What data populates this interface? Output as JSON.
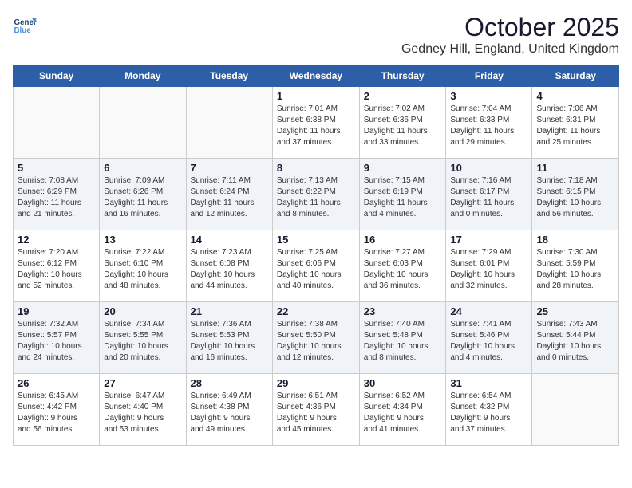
{
  "logo": {
    "line1": "General",
    "line2": "Blue"
  },
  "title": "October 2025",
  "location": "Gedney Hill, England, United Kingdom",
  "days_of_week": [
    "Sunday",
    "Monday",
    "Tuesday",
    "Wednesday",
    "Thursday",
    "Friday",
    "Saturday"
  ],
  "weeks": [
    [
      {
        "day": "",
        "info": ""
      },
      {
        "day": "",
        "info": ""
      },
      {
        "day": "",
        "info": ""
      },
      {
        "day": "1",
        "info": "Sunrise: 7:01 AM\nSunset: 6:38 PM\nDaylight: 11 hours\nand 37 minutes."
      },
      {
        "day": "2",
        "info": "Sunrise: 7:02 AM\nSunset: 6:36 PM\nDaylight: 11 hours\nand 33 minutes."
      },
      {
        "day": "3",
        "info": "Sunrise: 7:04 AM\nSunset: 6:33 PM\nDaylight: 11 hours\nand 29 minutes."
      },
      {
        "day": "4",
        "info": "Sunrise: 7:06 AM\nSunset: 6:31 PM\nDaylight: 11 hours\nand 25 minutes."
      }
    ],
    [
      {
        "day": "5",
        "info": "Sunrise: 7:08 AM\nSunset: 6:29 PM\nDaylight: 11 hours\nand 21 minutes."
      },
      {
        "day": "6",
        "info": "Sunrise: 7:09 AM\nSunset: 6:26 PM\nDaylight: 11 hours\nand 16 minutes."
      },
      {
        "day": "7",
        "info": "Sunrise: 7:11 AM\nSunset: 6:24 PM\nDaylight: 11 hours\nand 12 minutes."
      },
      {
        "day": "8",
        "info": "Sunrise: 7:13 AM\nSunset: 6:22 PM\nDaylight: 11 hours\nand 8 minutes."
      },
      {
        "day": "9",
        "info": "Sunrise: 7:15 AM\nSunset: 6:19 PM\nDaylight: 11 hours\nand 4 minutes."
      },
      {
        "day": "10",
        "info": "Sunrise: 7:16 AM\nSunset: 6:17 PM\nDaylight: 11 hours\nand 0 minutes."
      },
      {
        "day": "11",
        "info": "Sunrise: 7:18 AM\nSunset: 6:15 PM\nDaylight: 10 hours\nand 56 minutes."
      }
    ],
    [
      {
        "day": "12",
        "info": "Sunrise: 7:20 AM\nSunset: 6:12 PM\nDaylight: 10 hours\nand 52 minutes."
      },
      {
        "day": "13",
        "info": "Sunrise: 7:22 AM\nSunset: 6:10 PM\nDaylight: 10 hours\nand 48 minutes."
      },
      {
        "day": "14",
        "info": "Sunrise: 7:23 AM\nSunset: 6:08 PM\nDaylight: 10 hours\nand 44 minutes."
      },
      {
        "day": "15",
        "info": "Sunrise: 7:25 AM\nSunset: 6:06 PM\nDaylight: 10 hours\nand 40 minutes."
      },
      {
        "day": "16",
        "info": "Sunrise: 7:27 AM\nSunset: 6:03 PM\nDaylight: 10 hours\nand 36 minutes."
      },
      {
        "day": "17",
        "info": "Sunrise: 7:29 AM\nSunset: 6:01 PM\nDaylight: 10 hours\nand 32 minutes."
      },
      {
        "day": "18",
        "info": "Sunrise: 7:30 AM\nSunset: 5:59 PM\nDaylight: 10 hours\nand 28 minutes."
      }
    ],
    [
      {
        "day": "19",
        "info": "Sunrise: 7:32 AM\nSunset: 5:57 PM\nDaylight: 10 hours\nand 24 minutes."
      },
      {
        "day": "20",
        "info": "Sunrise: 7:34 AM\nSunset: 5:55 PM\nDaylight: 10 hours\nand 20 minutes."
      },
      {
        "day": "21",
        "info": "Sunrise: 7:36 AM\nSunset: 5:53 PM\nDaylight: 10 hours\nand 16 minutes."
      },
      {
        "day": "22",
        "info": "Sunrise: 7:38 AM\nSunset: 5:50 PM\nDaylight: 10 hours\nand 12 minutes."
      },
      {
        "day": "23",
        "info": "Sunrise: 7:40 AM\nSunset: 5:48 PM\nDaylight: 10 hours\nand 8 minutes."
      },
      {
        "day": "24",
        "info": "Sunrise: 7:41 AM\nSunset: 5:46 PM\nDaylight: 10 hours\nand 4 minutes."
      },
      {
        "day": "25",
        "info": "Sunrise: 7:43 AM\nSunset: 5:44 PM\nDaylight: 10 hours\nand 0 minutes."
      }
    ],
    [
      {
        "day": "26",
        "info": "Sunrise: 6:45 AM\nSunset: 4:42 PM\nDaylight: 9 hours\nand 56 minutes."
      },
      {
        "day": "27",
        "info": "Sunrise: 6:47 AM\nSunset: 4:40 PM\nDaylight: 9 hours\nand 53 minutes."
      },
      {
        "day": "28",
        "info": "Sunrise: 6:49 AM\nSunset: 4:38 PM\nDaylight: 9 hours\nand 49 minutes."
      },
      {
        "day": "29",
        "info": "Sunrise: 6:51 AM\nSunset: 4:36 PM\nDaylight: 9 hours\nand 45 minutes."
      },
      {
        "day": "30",
        "info": "Sunrise: 6:52 AM\nSunset: 4:34 PM\nDaylight: 9 hours\nand 41 minutes."
      },
      {
        "day": "31",
        "info": "Sunrise: 6:54 AM\nSunset: 4:32 PM\nDaylight: 9 hours\nand 37 minutes."
      },
      {
        "day": "",
        "info": ""
      }
    ]
  ]
}
